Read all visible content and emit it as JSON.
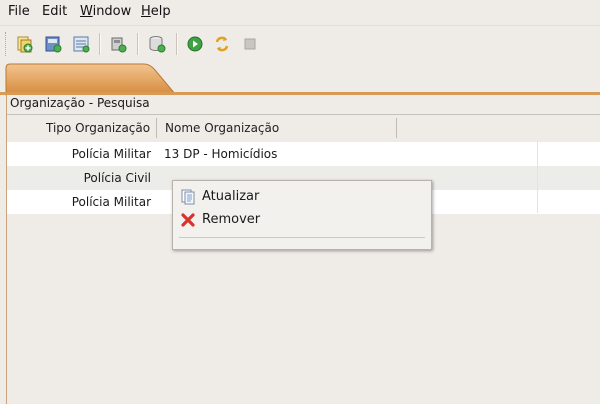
{
  "menubar": {
    "items": [
      {
        "label": "File"
      },
      {
        "label": "Edit"
      },
      {
        "label_underline": "W",
        "label_rest": "indow"
      },
      {
        "label_underline": "H",
        "label_rest": "elp"
      }
    ]
  },
  "toolbar": {
    "icons": [
      "new-document-icon",
      "save-form-icon",
      "list-form-icon",
      "database-icon",
      "database-add-icon",
      "run-icon",
      "refresh-icon",
      "stop-icon"
    ]
  },
  "panel": {
    "title": "Organização - Pesquisa"
  },
  "table": {
    "columns": [
      "Tipo Organização",
      "Nome Organização"
    ],
    "rows": [
      {
        "tipo": "Polícia Militar",
        "nome": "13 DP - Homicídios"
      },
      {
        "tipo": "Polícia Civil",
        "nome": ""
      },
      {
        "tipo": "Polícia Militar",
        "nome": ""
      }
    ]
  },
  "context_menu": {
    "items": [
      {
        "label": "Atualizar",
        "icon": "document-refresh-icon"
      },
      {
        "label": "Remover",
        "icon": "red-x-remove-icon"
      }
    ]
  },
  "colors": {
    "tab_accent": "#d99a55",
    "window_bg": "#efebe7",
    "remove_icon": "#d9342b"
  }
}
